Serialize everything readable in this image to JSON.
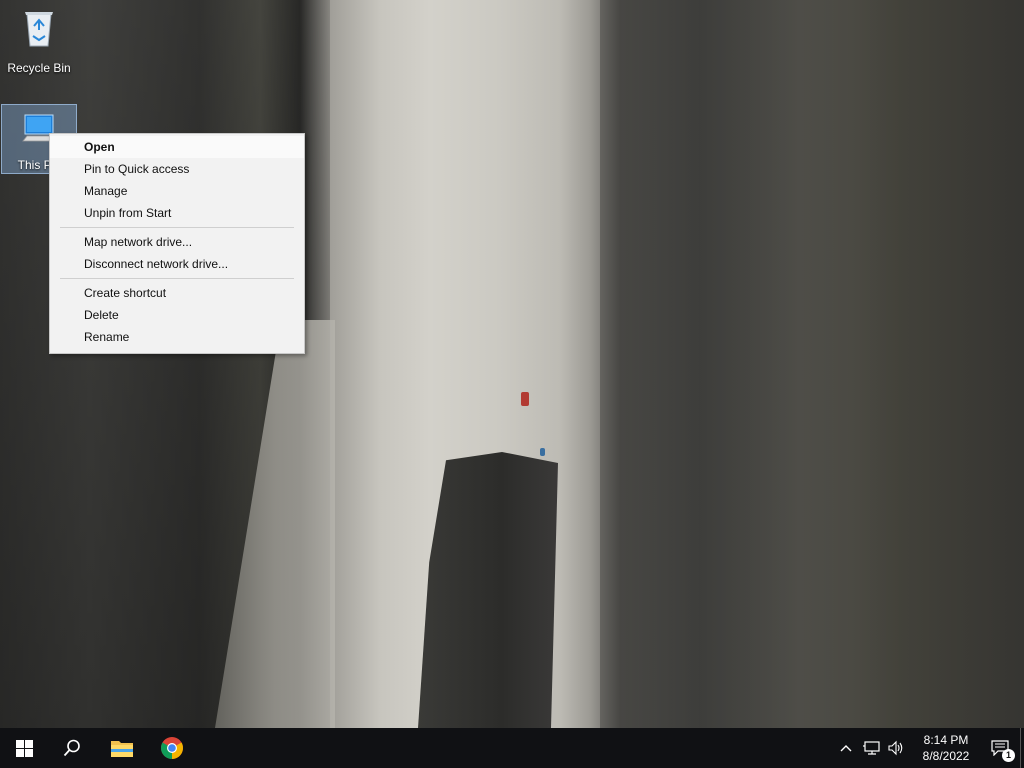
{
  "desktop": {
    "icons": [
      {
        "label": "Recycle Bin"
      },
      {
        "label": "This PC"
      }
    ]
  },
  "context_menu": {
    "groups": [
      [
        "Open",
        "Pin to Quick access",
        "Manage",
        "Unpin from Start"
      ],
      [
        "Map network drive...",
        "Disconnect network drive..."
      ],
      [
        "Create shortcut",
        "Delete",
        "Rename"
      ]
    ]
  },
  "taskbar": {
    "pinned": [
      "start-icon",
      "search-icon",
      "file-explorer-icon",
      "chrome-icon"
    ],
    "clock": {
      "time": "8:14 PM",
      "date": "8/8/2022"
    },
    "notifications": {
      "count": "1"
    }
  },
  "colors": {
    "taskbar": "#101114",
    "menu_bg": "#f2f2f2",
    "selection": "#99c9ff",
    "active_indicator": "#76b9ed"
  }
}
